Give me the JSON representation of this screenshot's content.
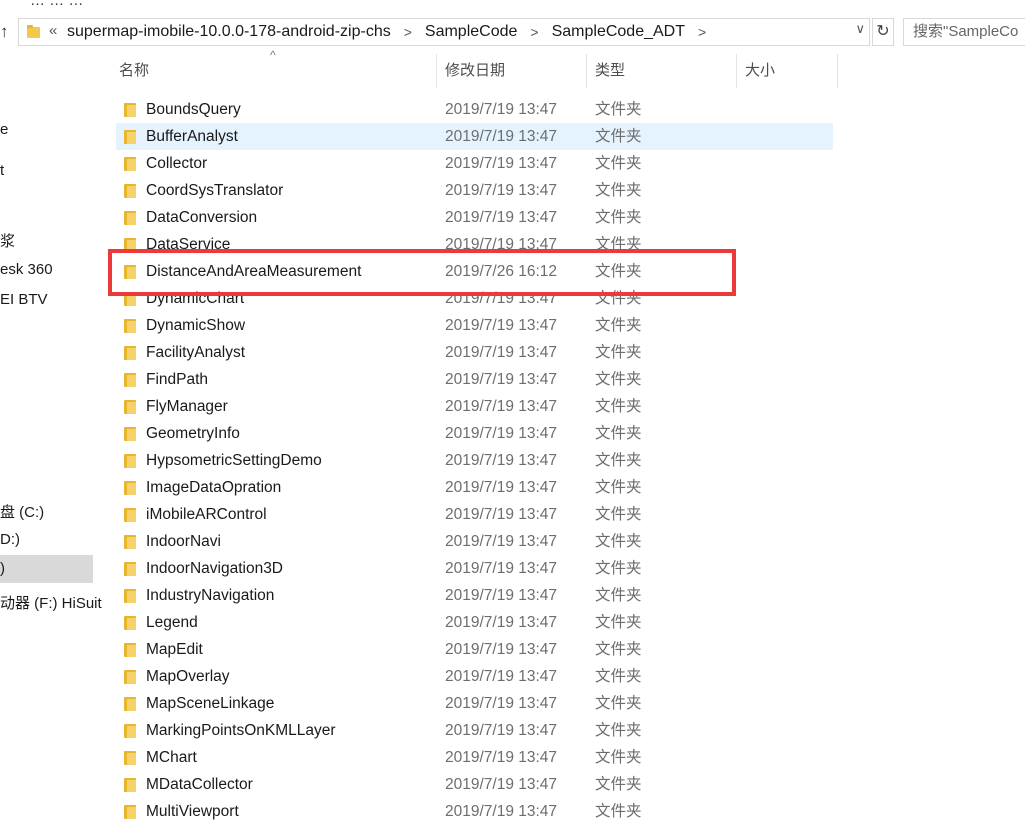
{
  "window": {
    "title_fragment": "…  …  …"
  },
  "address_bar": {
    "overflow_label": "«",
    "breadcrumbs": [
      "supermap-imobile-10.0.0-178-android-zip-chs",
      "SampleCode",
      "SampleCode_ADT"
    ],
    "separator": ">",
    "dropdown_glyph": "∨",
    "refresh_glyph": "↻",
    "up_glyph": "↑"
  },
  "search": {
    "text": "搜索\"SampleCo"
  },
  "nav_pane": {
    "items": [
      {
        "label": "e"
      },
      {
        "label": "t"
      },
      {
        "label": "浆"
      },
      {
        "label": "esk 360"
      },
      {
        "label": "EI BTV"
      },
      {
        "label": "盘 (C:)"
      },
      {
        "label": "D:)"
      },
      {
        "label": ")"
      },
      {
        "label": "动器 (F:) HiSuit"
      }
    ]
  },
  "columns": {
    "name": "名称",
    "date": "修改日期",
    "type": "类型",
    "size": "大小",
    "sort_glyph": "^"
  },
  "files": [
    {
      "name": "BoundsQuery",
      "date": "2019/7/19 13:47",
      "type": "文件夹"
    },
    {
      "name": "BufferAnalyst",
      "date": "2019/7/19 13:47",
      "type": "文件夹"
    },
    {
      "name": "Collector",
      "date": "2019/7/19 13:47",
      "type": "文件夹"
    },
    {
      "name": "CoordSysTranslator",
      "date": "2019/7/19 13:47",
      "type": "文件夹"
    },
    {
      "name": "DataConversion",
      "date": "2019/7/19 13:47",
      "type": "文件夹"
    },
    {
      "name": "DataService",
      "date": "2019/7/19 13:47",
      "type": "文件夹"
    },
    {
      "name": "DistanceAndAreaMeasurement",
      "date": "2019/7/26 16:12",
      "type": "文件夹"
    },
    {
      "name": "DynamicChart",
      "date": "2019/7/19 13:47",
      "type": "文件夹"
    },
    {
      "name": "DynamicShow",
      "date": "2019/7/19 13:47",
      "type": "文件夹"
    },
    {
      "name": "FacilityAnalyst",
      "date": "2019/7/19 13:47",
      "type": "文件夹"
    },
    {
      "name": "FindPath",
      "date": "2019/7/19 13:47",
      "type": "文件夹"
    },
    {
      "name": "FlyManager",
      "date": "2019/7/19 13:47",
      "type": "文件夹"
    },
    {
      "name": "GeometryInfo",
      "date": "2019/7/19 13:47",
      "type": "文件夹"
    },
    {
      "name": "HypsometricSettingDemo",
      "date": "2019/7/19 13:47",
      "type": "文件夹"
    },
    {
      "name": "ImageDataOpration",
      "date": "2019/7/19 13:47",
      "type": "文件夹"
    },
    {
      "name": "iMobileARControl",
      "date": "2019/7/19 13:47",
      "type": "文件夹"
    },
    {
      "name": "IndoorNavi",
      "date": "2019/7/19 13:47",
      "type": "文件夹"
    },
    {
      "name": "IndoorNavigation3D",
      "date": "2019/7/19 13:47",
      "type": "文件夹"
    },
    {
      "name": "IndustryNavigation",
      "date": "2019/7/19 13:47",
      "type": "文件夹"
    },
    {
      "name": "Legend",
      "date": "2019/7/19 13:47",
      "type": "文件夹"
    },
    {
      "name": "MapEdit",
      "date": "2019/7/19 13:47",
      "type": "文件夹"
    },
    {
      "name": "MapOverlay",
      "date": "2019/7/19 13:47",
      "type": "文件夹"
    },
    {
      "name": "MapSceneLinkage",
      "date": "2019/7/19 13:47",
      "type": "文件夹"
    },
    {
      "name": "MarkingPointsOnKMLLayer",
      "date": "2019/7/19 13:47",
      "type": "文件夹"
    },
    {
      "name": "MChart",
      "date": "2019/7/19 13:47",
      "type": "文件夹"
    },
    {
      "name": "MDataCollector",
      "date": "2019/7/19 13:47",
      "type": "文件夹"
    },
    {
      "name": "MultiViewport",
      "date": "2019/7/19 13:47",
      "type": "文件夹"
    }
  ],
  "colors": {
    "hover_row": "#e5f3ff",
    "annotation_box": "#ec3a3a",
    "nav_selected": "#d9d9d9",
    "folder_yellow": "#f7d26a"
  }
}
